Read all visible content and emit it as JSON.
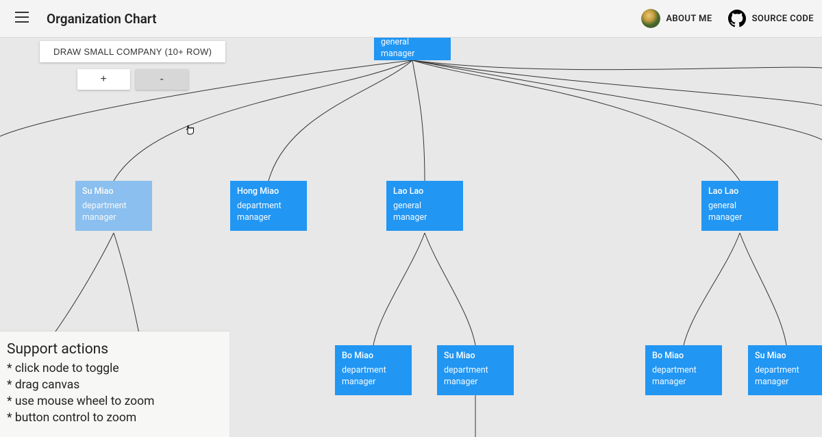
{
  "header": {
    "title": "Organization Chart",
    "about_label": "ABOUT ME",
    "source_label": "SOURCE CODE"
  },
  "toolbar": {
    "draw_label": "DRAW SMALL COMPANY (10+ ROW)",
    "zoom_in_label": "+",
    "zoom_out_label": "-"
  },
  "help": {
    "title": "Support actions",
    "lines": [
      "* click node to toggle",
      "* drag canvas",
      "* use mouse wheel to zoom",
      "* button control to zoom"
    ]
  },
  "nodes": {
    "root": {
      "name": "",
      "role": "general manager"
    },
    "su1": {
      "name": "Su Miao",
      "role": "department manager"
    },
    "hong": {
      "name": "Hong Miao",
      "role": "department manager"
    },
    "lao1": {
      "name": "Lao Lao",
      "role": "general manager"
    },
    "lao2": {
      "name": "Lao Lao",
      "role": "general manager"
    },
    "bo1": {
      "name": "Bo Miao",
      "role": "department manager"
    },
    "su2": {
      "name": "Su Miao",
      "role": "department manager"
    },
    "bo2": {
      "name": "Bo Miao",
      "role": "department manager"
    },
    "su3": {
      "name": "Su Miao",
      "role": "department manager"
    }
  },
  "colors": {
    "node_primary": "#2196f3",
    "node_faded": "#7ab9f1",
    "canvas_bg": "#e8e8e8"
  }
}
